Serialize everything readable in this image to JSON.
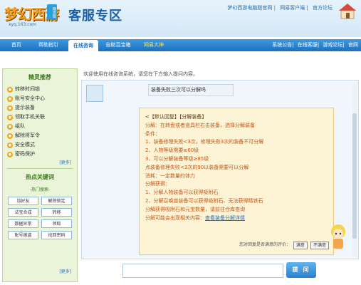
{
  "header": {
    "logo_text": "梦幻西游",
    "logo_badge": "网页版",
    "logo_sub": "xyq.163.com",
    "site_title": "客服专区",
    "top_links": [
      "梦幻西游电脑版官网",
      "网易客户端",
      "官方论坛"
    ]
  },
  "nav": {
    "items": [
      {
        "label": "首页",
        "active": false,
        "gold": false
      },
      {
        "label": "帮助指引",
        "active": false,
        "gold": false
      },
      {
        "label": "在线咨询",
        "active": true,
        "gold": false
      },
      {
        "label": "自助百宝箱",
        "active": false,
        "gold": false
      },
      {
        "label": "网易大神",
        "active": false,
        "gold": true
      }
    ],
    "right_links": [
      "系统公告",
      "在线客服",
      "游戏论坛",
      "官网"
    ]
  },
  "sidebar": {
    "title": "精灵推荐",
    "items": [
      "转移时间锁",
      "账号安全中心",
      "提示装备",
      "领取手机关联",
      "组队",
      "解除将军令",
      "安全模式",
      "密码保护"
    ],
    "more1": "[更多]",
    "keywords_title": "热点关键词",
    "keywords_sub": "-热门搜索-",
    "keywords": [
      "加好友",
      "解除锁定",
      "法宝合成",
      "转移",
      "数据异常",
      "领取",
      "账号被盗",
      "找回密码"
    ],
    "more2": "[更多]"
  },
  "main": {
    "notice": "欢迎使用在线咨询系统，请您在下方输入提问内容。",
    "user_question": "装备失败三次可以分解吗",
    "answer_lines": [
      {
        "text": "<【默认回复】【分解装备】",
        "dark": true
      },
      {
        "text": "分解：在转盘或者道具栏右击装备，选择分解装备",
        "dark": false
      },
      {
        "text": "条件：",
        "dark": false
      },
      {
        "text": "1、装备修理失败<3次，修理失败3次的装备不可分解",
        "dark": false
      },
      {
        "text": "2、人物等级需要≥60级",
        "dark": false
      },
      {
        "text": "3、可以分解装备等级≥85级",
        "dark": false
      },
      {
        "text": "点装备修理失败<3次的90以装备需要可以分解",
        "dark": false
      },
      {
        "text": "消耗：一定数量的体力",
        "dark": false
      },
      {
        "text": "分解获得：",
        "dark": false
      },
      {
        "text": "1、分解人物装备可以获得吸附石",
        "dark": false
      },
      {
        "text": "2、分解召唤兽装备可以获得吸附石、无法获得精铁石",
        "dark": false
      },
      {
        "text": "分解获得吸附石和元宝数量，请前往仓库查询",
        "dark": false
      },
      {
        "text": "分解可能会出现相关内容：",
        "dark": false
      }
    ],
    "answer_link": "查看装备分解详情",
    "feedback_text": "您对回复是否满意的评价：",
    "feedback_yes": "满意",
    "feedback_no": "不满意"
  },
  "input": {
    "placeholder": "",
    "submit_label": "提 问"
  }
}
